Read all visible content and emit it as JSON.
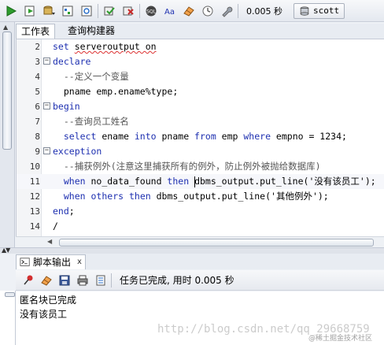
{
  "toolbar": {
    "buttons": [
      "run-statement",
      "run-script",
      "commit-dropdown",
      "explain-plan",
      "autotrace",
      "commit",
      "rollback",
      "sql-format",
      "text-case",
      "clear",
      "sql-history",
      "tune"
    ],
    "elapsed_time": "0.005 秒",
    "connection": "scott"
  },
  "tabs": {
    "worksheet": "工作表",
    "query_builder": "查询构建器"
  },
  "editor": {
    "lines": [
      {
        "n": "2",
        "text": "set serveroutput on"
      },
      {
        "n": "3",
        "text": "declare"
      },
      {
        "n": "4",
        "text": "  --定义一个变量"
      },
      {
        "n": "5",
        "text": "  pname emp.ename%type;"
      },
      {
        "n": "6",
        "text": "begin"
      },
      {
        "n": "7",
        "text": "  --查询员工姓名"
      },
      {
        "n": "8",
        "text": "  select ename into pname from emp where empno = 1234;"
      },
      {
        "n": "9",
        "text": "exception"
      },
      {
        "n": "10",
        "text": "  --捕获例外(注意这里捕获所有的例外，防止例外被抛给数据库)"
      },
      {
        "n": "11",
        "text": "  when no_data_found then dbms_output.put_line('没有该员工');"
      },
      {
        "n": "12",
        "text": "  when others then dbms_output.put_line('其他例外');"
      },
      {
        "n": "13",
        "text": "end;"
      },
      {
        "n": "14",
        "text": "/"
      }
    ]
  },
  "output": {
    "tab_label": "脚本输出",
    "close": "x",
    "status": "任务已完成, 用时 0.005 秒",
    "lines": [
      "匿名块已完成",
      "没有该员工"
    ],
    "watermark": "http://blog.csdn.net/qq_29668759",
    "watermark_corner": "@稀土掘金技术社区"
  },
  "colors": {
    "keyword": "#1d2fb0",
    "comment": "#555555",
    "run_green": "#2e9d2e"
  }
}
